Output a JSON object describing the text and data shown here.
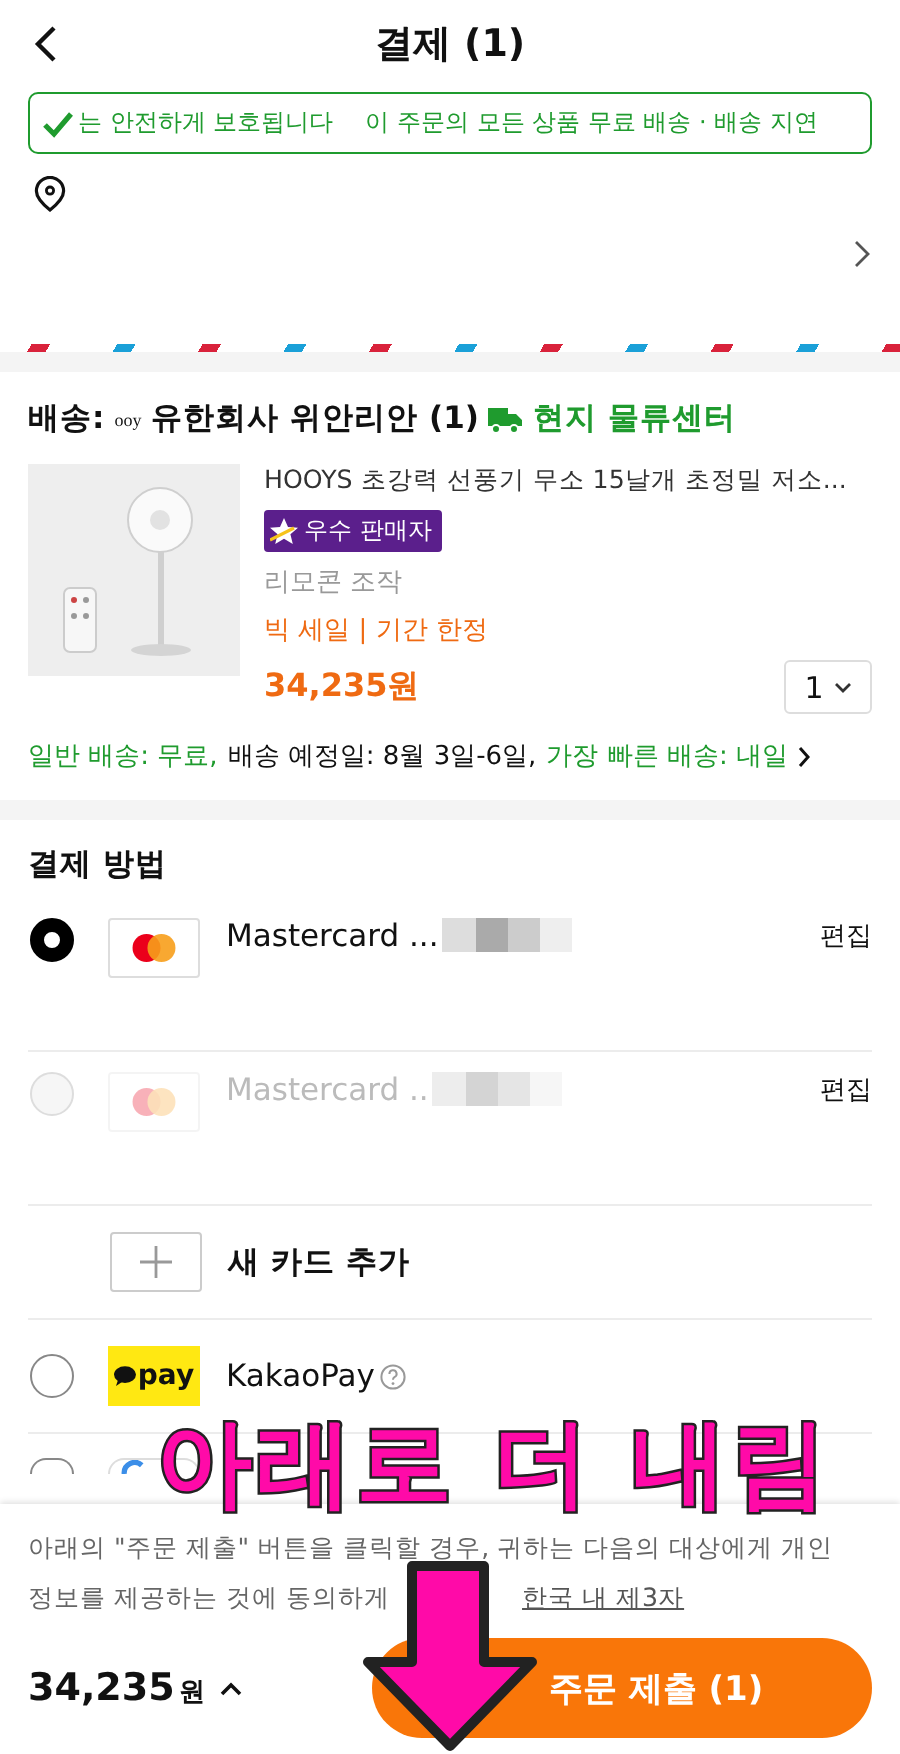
{
  "header": {
    "title": "결제 (1)"
  },
  "banner": {
    "texts": [
      "는 안전하게 보호됩니다",
      "이 주문의 모든 상품 무료 배송 · 배송 지연"
    ]
  },
  "shipping": {
    "label": "배송:",
    "seller_logo": "ooy",
    "seller": "유한회사 위안리안 (1)",
    "warehouse": "현지 물류센터",
    "product": {
      "kind": "picture",
      "title": "HOOYS 초강력 선풍기 무소 15날개 초정밀 저소...",
      "badge": "우수 판매자",
      "option": "리모콘 조작",
      "promo": "빅 세일 | 기간 한정",
      "price": "34,235원",
      "quantity": "1"
    },
    "delivery": {
      "standard": "일반 배송: 무료,",
      "estimate": "배송 예정일: 8월 3일-6일,",
      "fastest": "가장 빠른 배송: 내일"
    }
  },
  "payment": {
    "title": "결제 방법",
    "methods": [
      {
        "kind": "card",
        "label": "Mastercard ...",
        "action": "편집",
        "selected": true,
        "disabled": false
      },
      {
        "kind": "card",
        "label": "Mastercard ..",
        "action": "편집",
        "selected": false,
        "disabled": true
      },
      {
        "kind": "add",
        "label": "새 카드 추가"
      },
      {
        "kind": "kakao",
        "label": "KakaoPay",
        "logo": "pay",
        "selected": false,
        "disabled": false
      },
      {
        "kind": "other",
        "selected": false,
        "disabled": false
      }
    ]
  },
  "footer": {
    "consent": "아래의 \"주문 제출\" 버튼을 클릭할 경우, 귀하는 다음의 대상에게 개인 정보를 제공하는 것에 동의하게",
    "consent_link": "한국 내 제3자",
    "total": "34,235",
    "currency": "원",
    "submit": "주문 제출 (1)"
  },
  "annotation": {
    "text": "아래로 더 내림"
  }
}
